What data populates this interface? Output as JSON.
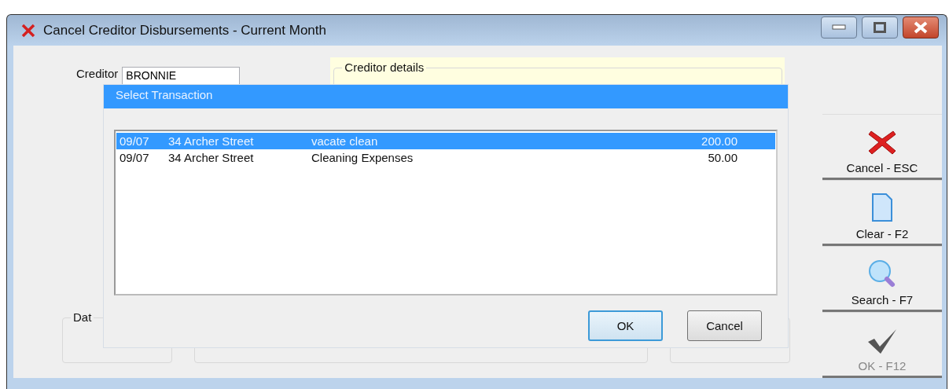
{
  "window": {
    "title": "Cancel Creditor Disbursements - Current Month"
  },
  "form": {
    "creditor_label": "Creditor",
    "creditor_value": "BRONNIE",
    "details_group": "Creditor details",
    "date_group": "Dat"
  },
  "actions": [
    {
      "label": "Cancel - ESC",
      "kind": "cancel",
      "disabled": false
    },
    {
      "label": "Clear - F2",
      "kind": "clear",
      "disabled": false
    },
    {
      "label": "Search - F7",
      "kind": "search",
      "disabled": false
    },
    {
      "label": "OK - F12",
      "kind": "ok",
      "disabled": true
    }
  ],
  "dialog": {
    "title": "Select Transaction",
    "rows": [
      {
        "date": "09/07",
        "property": "34 Archer Street",
        "description": "vacate clean",
        "amount": "200.00",
        "selected": true
      },
      {
        "date": "09/07",
        "property": "34 Archer Street",
        "description": "Cleaning Expenses",
        "amount": "50.00",
        "selected": false
      }
    ],
    "buttons": [
      {
        "label": "OK",
        "default": true
      },
      {
        "label": "Cancel",
        "default": false
      }
    ]
  }
}
